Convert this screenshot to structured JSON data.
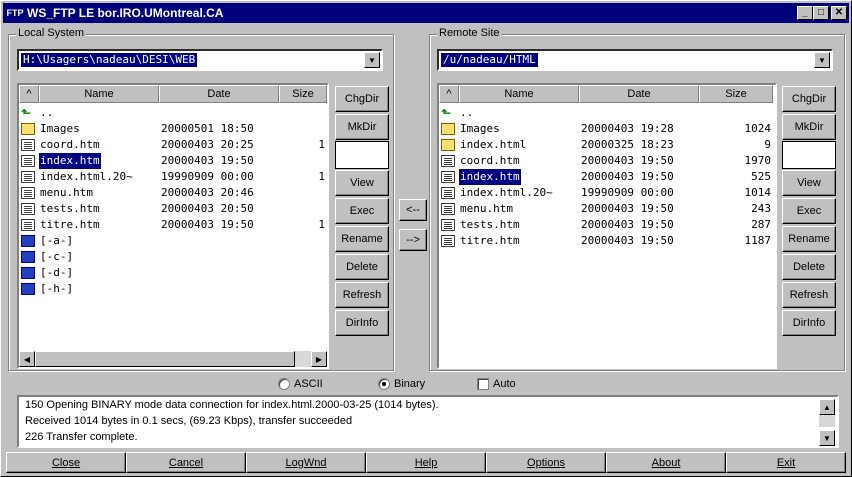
{
  "window": {
    "title": "WS_FTP LE bor.IRO.UMontreal.CA",
    "app_icon": "FTP"
  },
  "local": {
    "label": "Local System",
    "path": "H:\\Usagers\\nadeau\\DESI\\WEB",
    "headers": {
      "sort": "^",
      "name": "Name",
      "date": "Date",
      "size": "Size"
    },
    "files": [
      {
        "name": "..",
        "date": "",
        "size": "",
        "icon": "up-arrow-icon"
      },
      {
        "name": "Images",
        "date": "20000501 18:50",
        "size": "",
        "icon": "folder-icon"
      },
      {
        "name": "coord.htm",
        "date": "20000403 20:25",
        "size": "1",
        "icon": "file-icon"
      },
      {
        "name": "index.htm",
        "date": "20000403 19:50",
        "size": "",
        "icon": "file-icon",
        "selected": true
      },
      {
        "name": "index.html.20~",
        "date": "19990909 00:00",
        "size": "1",
        "icon": "file-icon"
      },
      {
        "name": "menu.htm",
        "date": "20000403 20:46",
        "size": "",
        "icon": "file-icon"
      },
      {
        "name": "tests.htm",
        "date": "20000403 20:50",
        "size": "",
        "icon": "file-icon"
      },
      {
        "name": "titre.htm",
        "date": "20000403 19:50",
        "size": "1",
        "icon": "file-icon"
      },
      {
        "name": "[-a-]",
        "date": "",
        "size": "",
        "icon": "drive-icon"
      },
      {
        "name": "[-c-]",
        "date": "",
        "size": "",
        "icon": "drive-icon"
      },
      {
        "name": "[-d-]",
        "date": "",
        "size": "",
        "icon": "drive-icon"
      },
      {
        "name": "[-h-]",
        "date": "",
        "size": "",
        "icon": "drive-icon"
      }
    ],
    "buttons": {
      "chgdir": "ChgDir",
      "mkdir": "MkDir",
      "view": "View",
      "exec": "Exec",
      "rename": "Rename",
      "delete": "Delete",
      "refresh": "Refresh",
      "dirinfo": "DirInfo"
    }
  },
  "remote": {
    "label": "Remote Site",
    "path": "/u/nadeau/HTML",
    "headers": {
      "sort": "^",
      "name": "Name",
      "date": "Date",
      "size": "Size"
    },
    "files": [
      {
        "name": "..",
        "date": "",
        "size": "",
        "icon": "up-arrow-icon"
      },
      {
        "name": "Images",
        "date": "20000403 19:28",
        "size": "1024",
        "icon": "folder-icon"
      },
      {
        "name": "index.html",
        "date": "20000325 18:23",
        "size": "9",
        "icon": "link-file-icon"
      },
      {
        "name": "coord.htm",
        "date": "20000403 19:50",
        "size": "1970",
        "icon": "file-icon"
      },
      {
        "name": "index.htm",
        "date": "20000403 19:50",
        "size": "525",
        "icon": "file-icon",
        "selected": true
      },
      {
        "name": "index.html.20~",
        "date": "19990909 00:00",
        "size": "1014",
        "icon": "file-icon"
      },
      {
        "name": "menu.htm",
        "date": "20000403 19:50",
        "size": "243",
        "icon": "file-icon"
      },
      {
        "name": "tests.htm",
        "date": "20000403 19:50",
        "size": "287",
        "icon": "file-icon"
      },
      {
        "name": "titre.htm",
        "date": "20000403 19:50",
        "size": "1187",
        "icon": "file-icon"
      }
    ],
    "buttons": {
      "chgdir": "ChgDir",
      "mkdir": "MkDir",
      "view": "View",
      "exec": "Exec",
      "rename": "Rename",
      "delete": "Delete",
      "refresh": "Refresh",
      "dirinfo": "DirInfo"
    }
  },
  "transfer": {
    "to_local": "<--",
    "to_remote": "-->"
  },
  "mode": {
    "ascii": "ASCII",
    "binary": "Binary",
    "auto": "Auto",
    "selected": "binary",
    "auto_checked": false
  },
  "log": [
    "150 Opening BINARY mode data connection for index.html.2000-03-25 (1014 bytes).",
    "Received 1014 bytes in 0.1 secs, (69.23 Kbps), transfer succeeded",
    "226 Transfer complete."
  ],
  "bottom": {
    "close": "Close",
    "cancel": "Cancel",
    "logwnd": "LogWnd",
    "help": "Help",
    "options": "Options",
    "about": "About",
    "exit": "Exit"
  },
  "colors": {
    "titlebar": "#00007b",
    "selection": "#000080",
    "face": "#c0c0c0"
  }
}
